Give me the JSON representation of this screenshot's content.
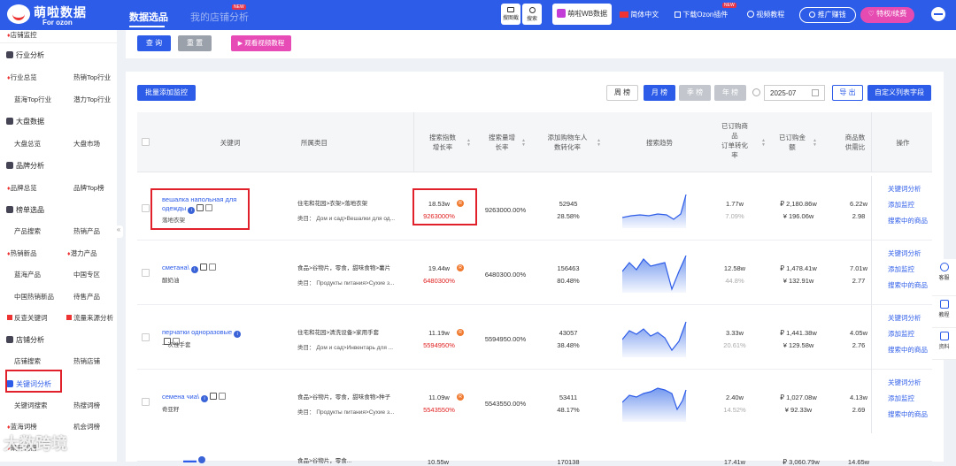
{
  "brand": {
    "name": "萌啦数据",
    "sub": "For ozon"
  },
  "nav": {
    "tab1": "数据选品",
    "tab2": "我的店铺分析",
    "new_tag": "NEW"
  },
  "topbar": {
    "screenshot_label": "搜图截",
    "search_label": "搜索",
    "wb_label": "萌啦WB数据",
    "lang_label": "简体中文",
    "download_label": "下载Ozon插件",
    "download_new": "NEW",
    "video_label": "视频教程",
    "promo_label": "推广赚钱",
    "vip_label": "特权/续费"
  },
  "sidebar": {
    "store_monitor": "店铺监控",
    "industry": "行业分析",
    "industry_overview": "行业总览",
    "hot_top_industry": "热销Top行业",
    "blue_top_industry": "蓝海Top行业",
    "potential_top_industry": "潜力Top行业",
    "market": "大盘数据",
    "market_overview": "大盘总览",
    "market_market": "大盘市场",
    "brand": "品牌分析",
    "brand_overview": "品牌总览",
    "brand_top": "品牌Top榜",
    "rank": "榜单选品",
    "product_search": "产品搜索",
    "hot_product": "热销产品",
    "hot_new": "热销新品",
    "potential_product": "潜力产品",
    "blue_product": "蓝海产品",
    "china_zone": "中国专区",
    "china_hot_new": "中国热销新品",
    "pending_product": "待售产品",
    "reverse_keyword": "反查关键词",
    "traffic_source": "流量来源分析",
    "store": "店铺分析",
    "store_search": "店铺搜索",
    "hot_store": "热销店铺",
    "keyword_analysis": "关键词分析",
    "keyword_search": "关键词搜索",
    "hot_search_words": "热搜词榜",
    "blue_words": "蓝海词榜",
    "opportunity_words": "机会词榜",
    "rising_words": "飙升词榜"
  },
  "filters": {
    "query": "查 询",
    "reset": "重 置",
    "video": "观看视频教程"
  },
  "toolbar": {
    "batch_monitor": "批量添加监控",
    "week": "周 榜",
    "month": "月 榜",
    "quarter": "季 榜",
    "year": "年 榜",
    "date": "2025-07",
    "export": "导 出",
    "custom_columns": "自定义列表字段"
  },
  "table": {
    "headers": {
      "keyword": "关键词",
      "category": "所属类目",
      "search_index": [
        "搜索指数",
        "增长率"
      ],
      "search_volume": [
        "搜索量增",
        "长率"
      ],
      "cart_rate": [
        "添加购物车人",
        "数转化率"
      ],
      "trend": "搜索趋势",
      "ordered": [
        "已订购商",
        "品",
        "订单转化",
        "率"
      ],
      "ordered_amount": [
        "已订购金",
        "额"
      ],
      "supply": [
        "商品数",
        "供需比"
      ],
      "ops": "操作"
    },
    "cat_prefix": "类目：",
    "actions": [
      "关键词分析",
      "添加监控",
      "搜索中的商品"
    ],
    "rows": [
      {
        "kw": "вешалка напольная для одежды",
        "kw_cn": "落地衣架",
        "cat1": "住宅和花园>衣架>落地衣架",
        "cat2": "Дом и сад>Вешалки для од...",
        "index": "18.53w",
        "index_growth": "9263000%",
        "vol_growth": "9263000.00%",
        "cart": "52945",
        "cart_rate": "28.58%",
        "ordered": "1.77w",
        "order_rate": "7.09%",
        "amount_rub": "₽ 2,180.86w",
        "amount_cny": "¥ 196.06w",
        "goods": "6.22w",
        "supply": "2.98"
      },
      {
        "kw": "сметана\\",
        "kw_cn": "酸奶油",
        "cat1": "食品>谷物片，零食，甜味食物>薯片",
        "cat2": "Продукты питания>Сухие з...",
        "index": "19.44w",
        "index_growth": "6480300%",
        "vol_growth": "6480300.00%",
        "cart": "156463",
        "cart_rate": "80.48%",
        "ordered": "12.58w",
        "order_rate": "44.8%",
        "amount_rub": "₽ 1,478.41w",
        "amount_cny": "¥ 132.91w",
        "goods": "7.01w",
        "supply": "2.77"
      },
      {
        "kw": "перчатки одноразовые",
        "kw_cn": "一次性手套",
        "cat1": "住宅和花园>清洗设备>家用手套",
        "cat2": "Дом и сад>Инвентарь для ...",
        "index": "11.19w",
        "index_growth": "5594950%",
        "vol_growth": "5594950.00%",
        "cart": "43057",
        "cart_rate": "38.48%",
        "ordered": "3.33w",
        "order_rate": "20.61%",
        "amount_rub": "₽ 1,441.38w",
        "amount_cny": "¥ 129.58w",
        "goods": "4.05w",
        "supply": "2.76"
      },
      {
        "kw": "семена чиа\\",
        "kw_cn": "奇亚籽",
        "cat1": "食品>谷物片，零食，甜味食物>种子",
        "cat2": "Продукты питания>Сухие з...",
        "index": "11.09w",
        "index_growth": "5543550%",
        "vol_growth": "5543550.00%",
        "cart": "53411",
        "cart_rate": "48.17%",
        "ordered": "2.40w",
        "order_rate": "14.52%",
        "amount_rub": "₽ 1,027.08w",
        "amount_cny": "¥ 92.33w",
        "goods": "4.13w",
        "supply": "2.69"
      }
    ],
    "partial_row": {
      "index": "10.55w",
      "cart": "170138",
      "ordered": "17.41w",
      "amount": "₽ 3,060.79w",
      "goods": "14.65w",
      "cat1": "食品>谷物片，零食..."
    }
  },
  "right_rail": {
    "service": "客服",
    "tutorial": "教程",
    "material": "资料"
  },
  "watermark": "大数跨境"
}
